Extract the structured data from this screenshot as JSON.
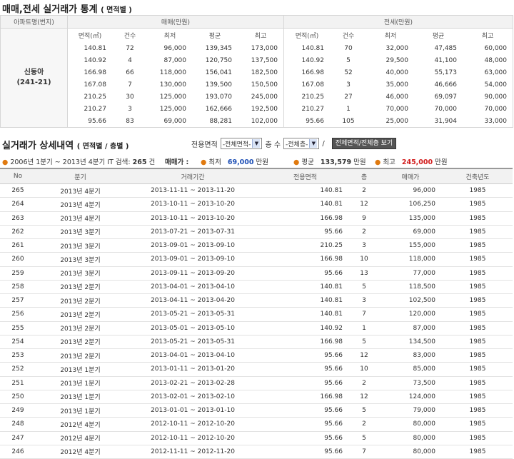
{
  "title": {
    "main": "매매,전세 실거래가 통계",
    "sub": "( 면적별 )"
  },
  "stats": {
    "header_apt": "아파트명(번지)",
    "header_sale": "매매(만원)",
    "header_jeonse": "전세(만원)",
    "apt_name": "신동아",
    "apt_addr": "(241-21)",
    "sale_cols": [
      "면적(㎡)",
      "건수",
      "최저",
      "평균",
      "최고"
    ],
    "jeonse_cols": [
      "면적(㎡)",
      "건수",
      "최저",
      "평균",
      "최고"
    ],
    "sale_rows": [
      [
        "140.81",
        "72",
        "96,000",
        "139,345",
        "173,000"
      ],
      [
        "140.92",
        "4",
        "87,000",
        "120,750",
        "137,500"
      ],
      [
        "166.98",
        "66",
        "118,000",
        "156,041",
        "182,500"
      ],
      [
        "167.08",
        "7",
        "130,000",
        "139,500",
        "150,500"
      ],
      [
        "210.25",
        "30",
        "125,000",
        "193,070",
        "245,000"
      ],
      [
        "210.27",
        "3",
        "125,000",
        "162,666",
        "192,500"
      ],
      [
        "95.66",
        "83",
        "69,000",
        "88,281",
        "102,000"
      ]
    ],
    "jeonse_rows": [
      [
        "140.81",
        "70",
        "32,000",
        "47,485",
        "60,000"
      ],
      [
        "140.92",
        "5",
        "29,500",
        "41,100",
        "48,000"
      ],
      [
        "166.98",
        "52",
        "40,000",
        "55,173",
        "63,000"
      ],
      [
        "167.08",
        "3",
        "35,000",
        "46,666",
        "54,000"
      ],
      [
        "210.25",
        "27",
        "46,000",
        "69,097",
        "90,000"
      ],
      [
        "210.27",
        "1",
        "70,000",
        "70,000",
        "70,000"
      ],
      [
        "95.66",
        "105",
        "25,000",
        "31,904",
        "33,000"
      ]
    ]
  },
  "detail_section": {
    "main": "실거래가 상세내역",
    "sub": "( 면적별 / 층별 )"
  },
  "filter": {
    "area_label": "전용면적",
    "area_value": "-전체면적-",
    "floor_label": "층 수",
    "floor_value": "-전체층-",
    "slash": "/",
    "button": "전체면적/전체층 보기"
  },
  "summary": {
    "period": "2006년 1분기 ~ 2013년 4분기 IT 검색:",
    "count": "265",
    "count_unit": "건",
    "price_label": "매매가 :",
    "min_label": "최저",
    "min_value": "69,000",
    "avg_label": "평균",
    "avg_value": "133,579",
    "max_label": "최고",
    "max_value": "245,000",
    "unit": "만원"
  },
  "detail": {
    "cols": [
      "No",
      "분기",
      "거래기간",
      "전용면적",
      "층",
      "매매가",
      "건축년도"
    ],
    "rows": [
      [
        "265",
        "2013년 4분기",
        "2013-11-11 ~ 2013-11-20",
        "140.81",
        "2",
        "96,000",
        "1985"
      ],
      [
        "264",
        "2013년 4분기",
        "2013-10-11 ~ 2013-10-20",
        "140.81",
        "12",
        "106,250",
        "1985"
      ],
      [
        "263",
        "2013년 4분기",
        "2013-10-11 ~ 2013-10-20",
        "166.98",
        "9",
        "135,000",
        "1985"
      ],
      [
        "262",
        "2013년 3분기",
        "2013-07-21 ~ 2013-07-31",
        "95.66",
        "2",
        "69,000",
        "1985"
      ],
      [
        "261",
        "2013년 3분기",
        "2013-09-01 ~ 2013-09-10",
        "210.25",
        "3",
        "155,000",
        "1985"
      ],
      [
        "260",
        "2013년 3분기",
        "2013-09-01 ~ 2013-09-10",
        "166.98",
        "10",
        "118,000",
        "1985"
      ],
      [
        "259",
        "2013년 3분기",
        "2013-09-11 ~ 2013-09-20",
        "95.66",
        "13",
        "77,000",
        "1985"
      ],
      [
        "258",
        "2013년 2분기",
        "2013-04-01 ~ 2013-04-10",
        "140.81",
        "5",
        "118,500",
        "1985"
      ],
      [
        "257",
        "2013년 2분기",
        "2013-04-11 ~ 2013-04-20",
        "140.81",
        "3",
        "102,500",
        "1985"
      ],
      [
        "256",
        "2013년 2분기",
        "2013-05-21 ~ 2013-05-31",
        "140.81",
        "7",
        "120,000",
        "1985"
      ],
      [
        "255",
        "2013년 2분기",
        "2013-05-01 ~ 2013-05-10",
        "140.92",
        "1",
        "87,000",
        "1985"
      ],
      [
        "254",
        "2013년 2분기",
        "2013-05-21 ~ 2013-05-31",
        "166.98",
        "5",
        "134,500",
        "1985"
      ],
      [
        "253",
        "2013년 2분기",
        "2013-04-01 ~ 2013-04-10",
        "95.66",
        "12",
        "83,000",
        "1985"
      ],
      [
        "252",
        "2013년 1분기",
        "2013-01-11 ~ 2013-01-20",
        "95.66",
        "10",
        "85,000",
        "1985"
      ],
      [
        "251",
        "2013년 1분기",
        "2013-02-21 ~ 2013-02-28",
        "95.66",
        "2",
        "73,500",
        "1985"
      ],
      [
        "250",
        "2013년 1분기",
        "2013-02-01 ~ 2013-02-10",
        "166.98",
        "12",
        "124,000",
        "1985"
      ],
      [
        "249",
        "2013년 1분기",
        "2013-01-01 ~ 2013-01-10",
        "95.66",
        "5",
        "79,000",
        "1985"
      ],
      [
        "248",
        "2012년 4분기",
        "2012-10-11 ~ 2012-10-20",
        "95.66",
        "2",
        "80,000",
        "1985"
      ],
      [
        "247",
        "2012년 4분기",
        "2012-10-11 ~ 2012-10-20",
        "95.66",
        "5",
        "80,000",
        "1985"
      ],
      [
        "246",
        "2012년 4분기",
        "2012-11-11 ~ 2012-11-20",
        "95.66",
        "7",
        "80,000",
        "1985"
      ]
    ]
  }
}
